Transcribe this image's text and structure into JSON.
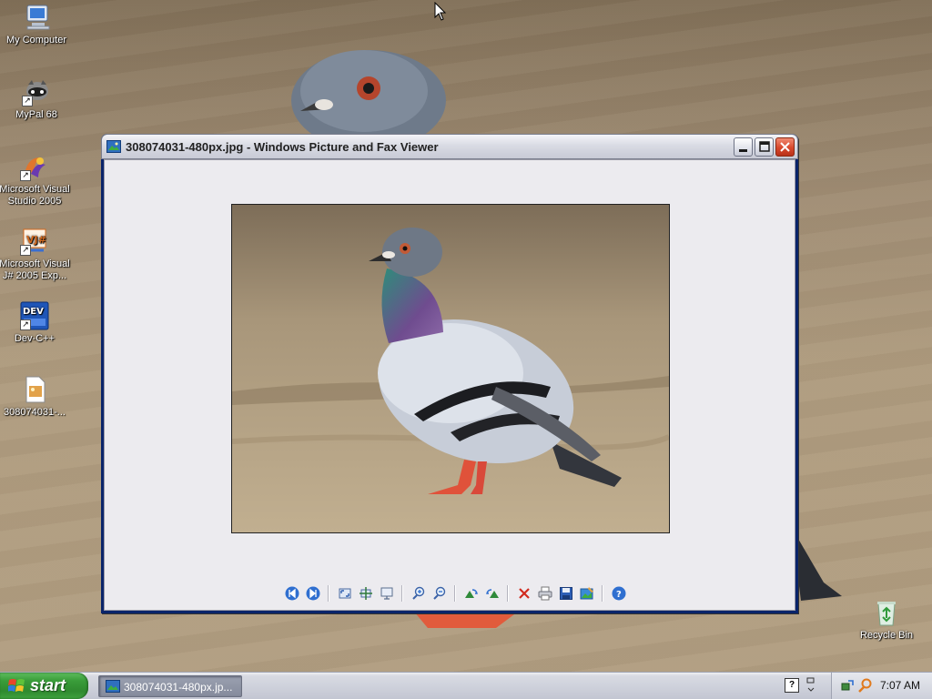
{
  "desktop": {
    "icons": [
      {
        "label": "My Computer"
      },
      {
        "label": "MyPal 68"
      },
      {
        "label": "Microsoft Visual Studio 2005"
      },
      {
        "label": "Microsoft Visual J# 2005 Exp..."
      },
      {
        "label": "Dev-C++"
      },
      {
        "label": "308074031-..."
      }
    ],
    "recycle_bin": {
      "label": "Recycle Bin"
    }
  },
  "window": {
    "title": "308074031-480px.jpg - Windows Picture and Fax Viewer",
    "toolbar": {
      "buttons": [
        {
          "icon": "previous-image-icon"
        },
        {
          "icon": "next-image-icon"
        },
        {
          "icon": "best-fit-icon"
        },
        {
          "icon": "actual-size-icon"
        },
        {
          "icon": "slide-show-icon"
        },
        {
          "icon": "zoom-in-icon"
        },
        {
          "icon": "zoom-out-icon"
        },
        {
          "icon": "rotate-clockwise-icon"
        },
        {
          "icon": "rotate-counterclockwise-icon"
        },
        {
          "icon": "delete-icon"
        },
        {
          "icon": "print-icon"
        },
        {
          "icon": "save-icon"
        },
        {
          "icon": "edit-image-icon"
        },
        {
          "icon": "help-icon"
        }
      ]
    }
  },
  "taskbar": {
    "start_label": "start",
    "task_label": "308074031-480px.jp...",
    "clock": "7:07 AM"
  },
  "colors": {
    "xp_start_green": "#3a9d3a",
    "title_bar": "#d9dbe4",
    "close_red": "#d8482c",
    "toolbar_blue": "#2f6fd0"
  }
}
